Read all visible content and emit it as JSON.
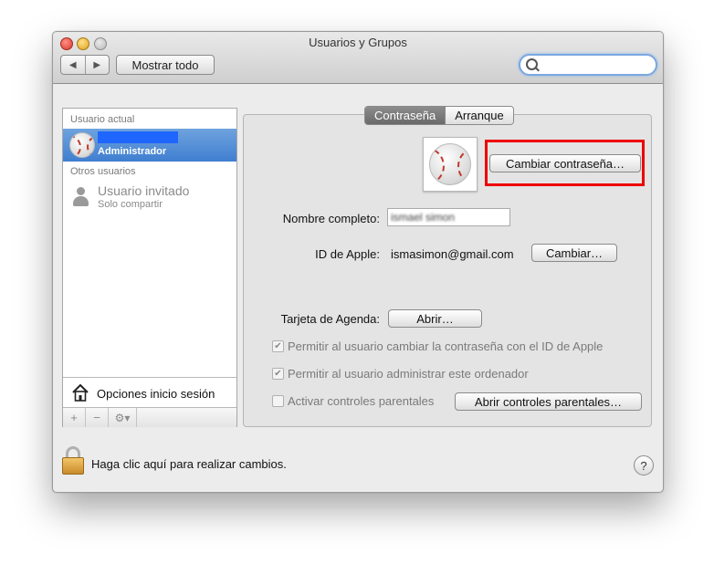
{
  "window": {
    "title": "Usuarios y Grupos",
    "nav_back": "◀",
    "nav_forward": "▶",
    "show_all": "Mostrar todo",
    "search_placeholder": ""
  },
  "sidebar": {
    "current_user_header": "Usuario actual",
    "current_user_role": "Administrador",
    "other_users_header": "Otros usuarios",
    "guest_name": "Usuario invitado",
    "guest_sub": "Solo compartir",
    "login_options": "Opciones inicio sesión",
    "add_label": "+",
    "remove_label": "−",
    "gear_label": "⚙▾"
  },
  "tabs": [
    {
      "label": "Contraseña",
      "active": true
    },
    {
      "label": "Arranque",
      "active": false
    }
  ],
  "panel": {
    "change_password_button": "Cambiar contraseña…",
    "full_name_label": "Nombre completo:",
    "full_name_value": "ismael simon",
    "apple_id_label": "ID de Apple:",
    "apple_id_value": "ismasimon@gmail.com",
    "change_button": "Cambiar…",
    "card_label": "Tarjeta de Agenda:",
    "open_button": "Abrir…",
    "check1_label": "Permitir al usuario cambiar la contraseña con el ID de Apple",
    "check1_checked": "✔",
    "check2_label": "Permitir al usuario administrar este ordenador",
    "check2_checked": "✔",
    "check3_label": "Activar controles parentales",
    "parental_button": "Abrir controles parentales…"
  },
  "footer": {
    "lock_text": "Haga clic aquí para realizar cambios.",
    "help": "?"
  },
  "colors": {
    "selection": "#3f7fd0",
    "highlight_box": "#ee0000",
    "redaction": "#1f66ff"
  }
}
